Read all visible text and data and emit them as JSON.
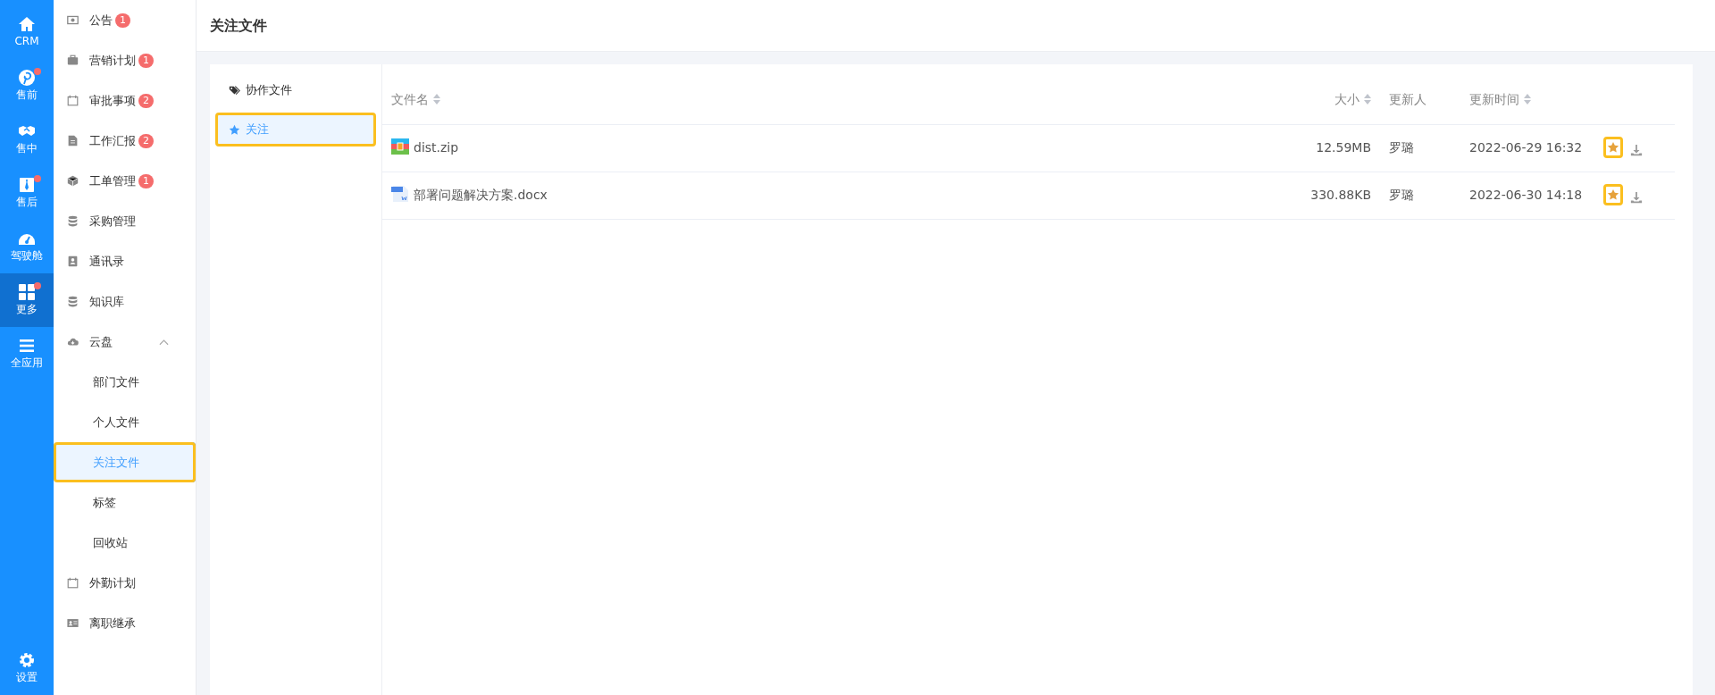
{
  "rail": [
    {
      "label": "CRM",
      "dot": false,
      "selected": false
    },
    {
      "label": "售前",
      "dot": true,
      "selected": false
    },
    {
      "label": "售中",
      "dot": false,
      "selected": false
    },
    {
      "label": "售后",
      "dot": true,
      "selected": false
    },
    {
      "label": "驾驶舱",
      "dot": false,
      "selected": false
    },
    {
      "label": "更多",
      "dot": true,
      "selected": true
    },
    {
      "label": "全应用",
      "dot": false,
      "selected": false
    }
  ],
  "rail_bottom": {
    "label": "设置"
  },
  "sidebar": {
    "items": [
      {
        "label": "公告",
        "badge": "1"
      },
      {
        "label": "营销计划",
        "badge": "1"
      },
      {
        "label": "审批事项",
        "badge": "2"
      },
      {
        "label": "工作汇报",
        "badge": "2"
      },
      {
        "label": "工单管理",
        "badge": "1"
      },
      {
        "label": "采购管理"
      },
      {
        "label": "通讯录"
      },
      {
        "label": "知识库"
      },
      {
        "label": "云盘",
        "expanded": true,
        "children": [
          {
            "label": "部门文件",
            "selected": false,
            "highlighted": false
          },
          {
            "label": "个人文件",
            "selected": false,
            "highlighted": false
          },
          {
            "label": "关注文件",
            "selected": true,
            "highlighted": true
          },
          {
            "label": "标签",
            "selected": false,
            "highlighted": false
          },
          {
            "label": "回收站",
            "selected": false,
            "highlighted": false
          }
        ]
      },
      {
        "label": "外勤计划"
      },
      {
        "label": "离职继承"
      }
    ]
  },
  "page_title": "关注文件",
  "file_tabs": [
    {
      "label": "协作文件",
      "selected": false,
      "highlighted": false
    },
    {
      "label": "关注",
      "selected": true,
      "highlighted": true
    }
  ],
  "table": {
    "columns": [
      {
        "label": "文件名",
        "sortable": true
      },
      {
        "label": "大小",
        "sortable": true
      },
      {
        "label": "更新人",
        "sortable": false
      },
      {
        "label": "更新时间",
        "sortable": true
      }
    ],
    "star_column_highlighted": true,
    "rows": [
      {
        "kind": "zip",
        "name": "dist.zip",
        "size": "12.59MB",
        "updater": "罗璐",
        "time": "2022-06-29 16:32",
        "starred": true
      },
      {
        "kind": "docx",
        "name": "部署问题解决方案.docx",
        "size": "330.88KB",
        "updater": "罗璐",
        "time": "2022-06-30 14:18",
        "starred": true
      }
    ]
  }
}
